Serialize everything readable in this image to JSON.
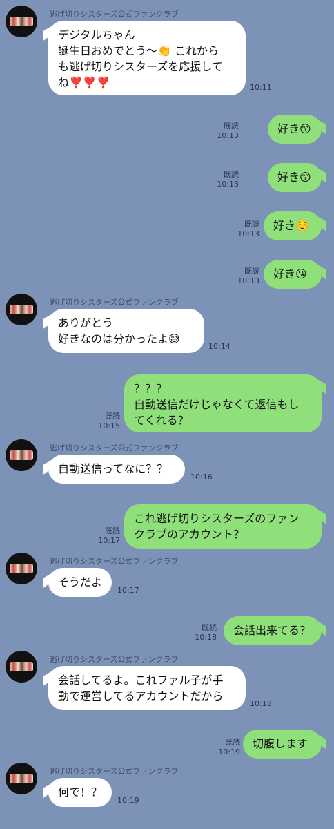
{
  "chat": {
    "messages": [
      {
        "type": "in",
        "sender": "逃げ切りシスターズ公式ファンクラブ",
        "text": "デジタルちゃん\n誕生日おめでとう〜👏 これから\nも逃げ切りシスターズを応援して\nね❣️❣️❣️",
        "time": "10:11"
      },
      {
        "type": "out",
        "read": "既読",
        "text": "好き😙",
        "time": "10:13"
      },
      {
        "type": "out",
        "read": "既読",
        "text": "好き😙",
        "time": "10:13"
      },
      {
        "type": "out",
        "read": "既読",
        "text": "好き☺️",
        "time": "10:13"
      },
      {
        "type": "out",
        "read": "既読",
        "text": "好き😘",
        "time": "10:13"
      },
      {
        "type": "in",
        "sender": "逃げ切りシスターズ公式ファンクラブ",
        "text": "ありがとう\n好きなのは分かったよ😅",
        "time": "10:14"
      },
      {
        "type": "out",
        "read": "既読",
        "text": "？？？\n自動送信だけじゃなくて返信もし\nてくれる？",
        "time": "10:15"
      },
      {
        "type": "in",
        "sender": "逃げ切りシスターズ公式ファンクラブ",
        "text": "自動送信ってなに？？",
        "time": "10:16"
      },
      {
        "type": "out",
        "read": "既読",
        "text": "これ逃げ切りシスターズのファン\nクラブのアカウント？",
        "time": "10:17"
      },
      {
        "type": "in",
        "sender": "逃げ切りシスターズ公式ファンクラブ",
        "text": "そうだよ",
        "time": "10:17"
      },
      {
        "type": "out",
        "read": "既読",
        "text": "会話出来てる？",
        "time": "10:18"
      },
      {
        "type": "in",
        "sender": "逃げ切りシスターズ公式ファンクラブ",
        "text": "会話してるよ。これファル子が手\n動で運営してるアカウントだから",
        "time": "10:18"
      },
      {
        "type": "out",
        "read": "既読",
        "text": "切腹します",
        "time": "10:19"
      },
      {
        "type": "in",
        "sender": "逃げ切りシスターズ公式ファンクラブ",
        "text": "何で！？",
        "time": "10:19"
      }
    ]
  }
}
